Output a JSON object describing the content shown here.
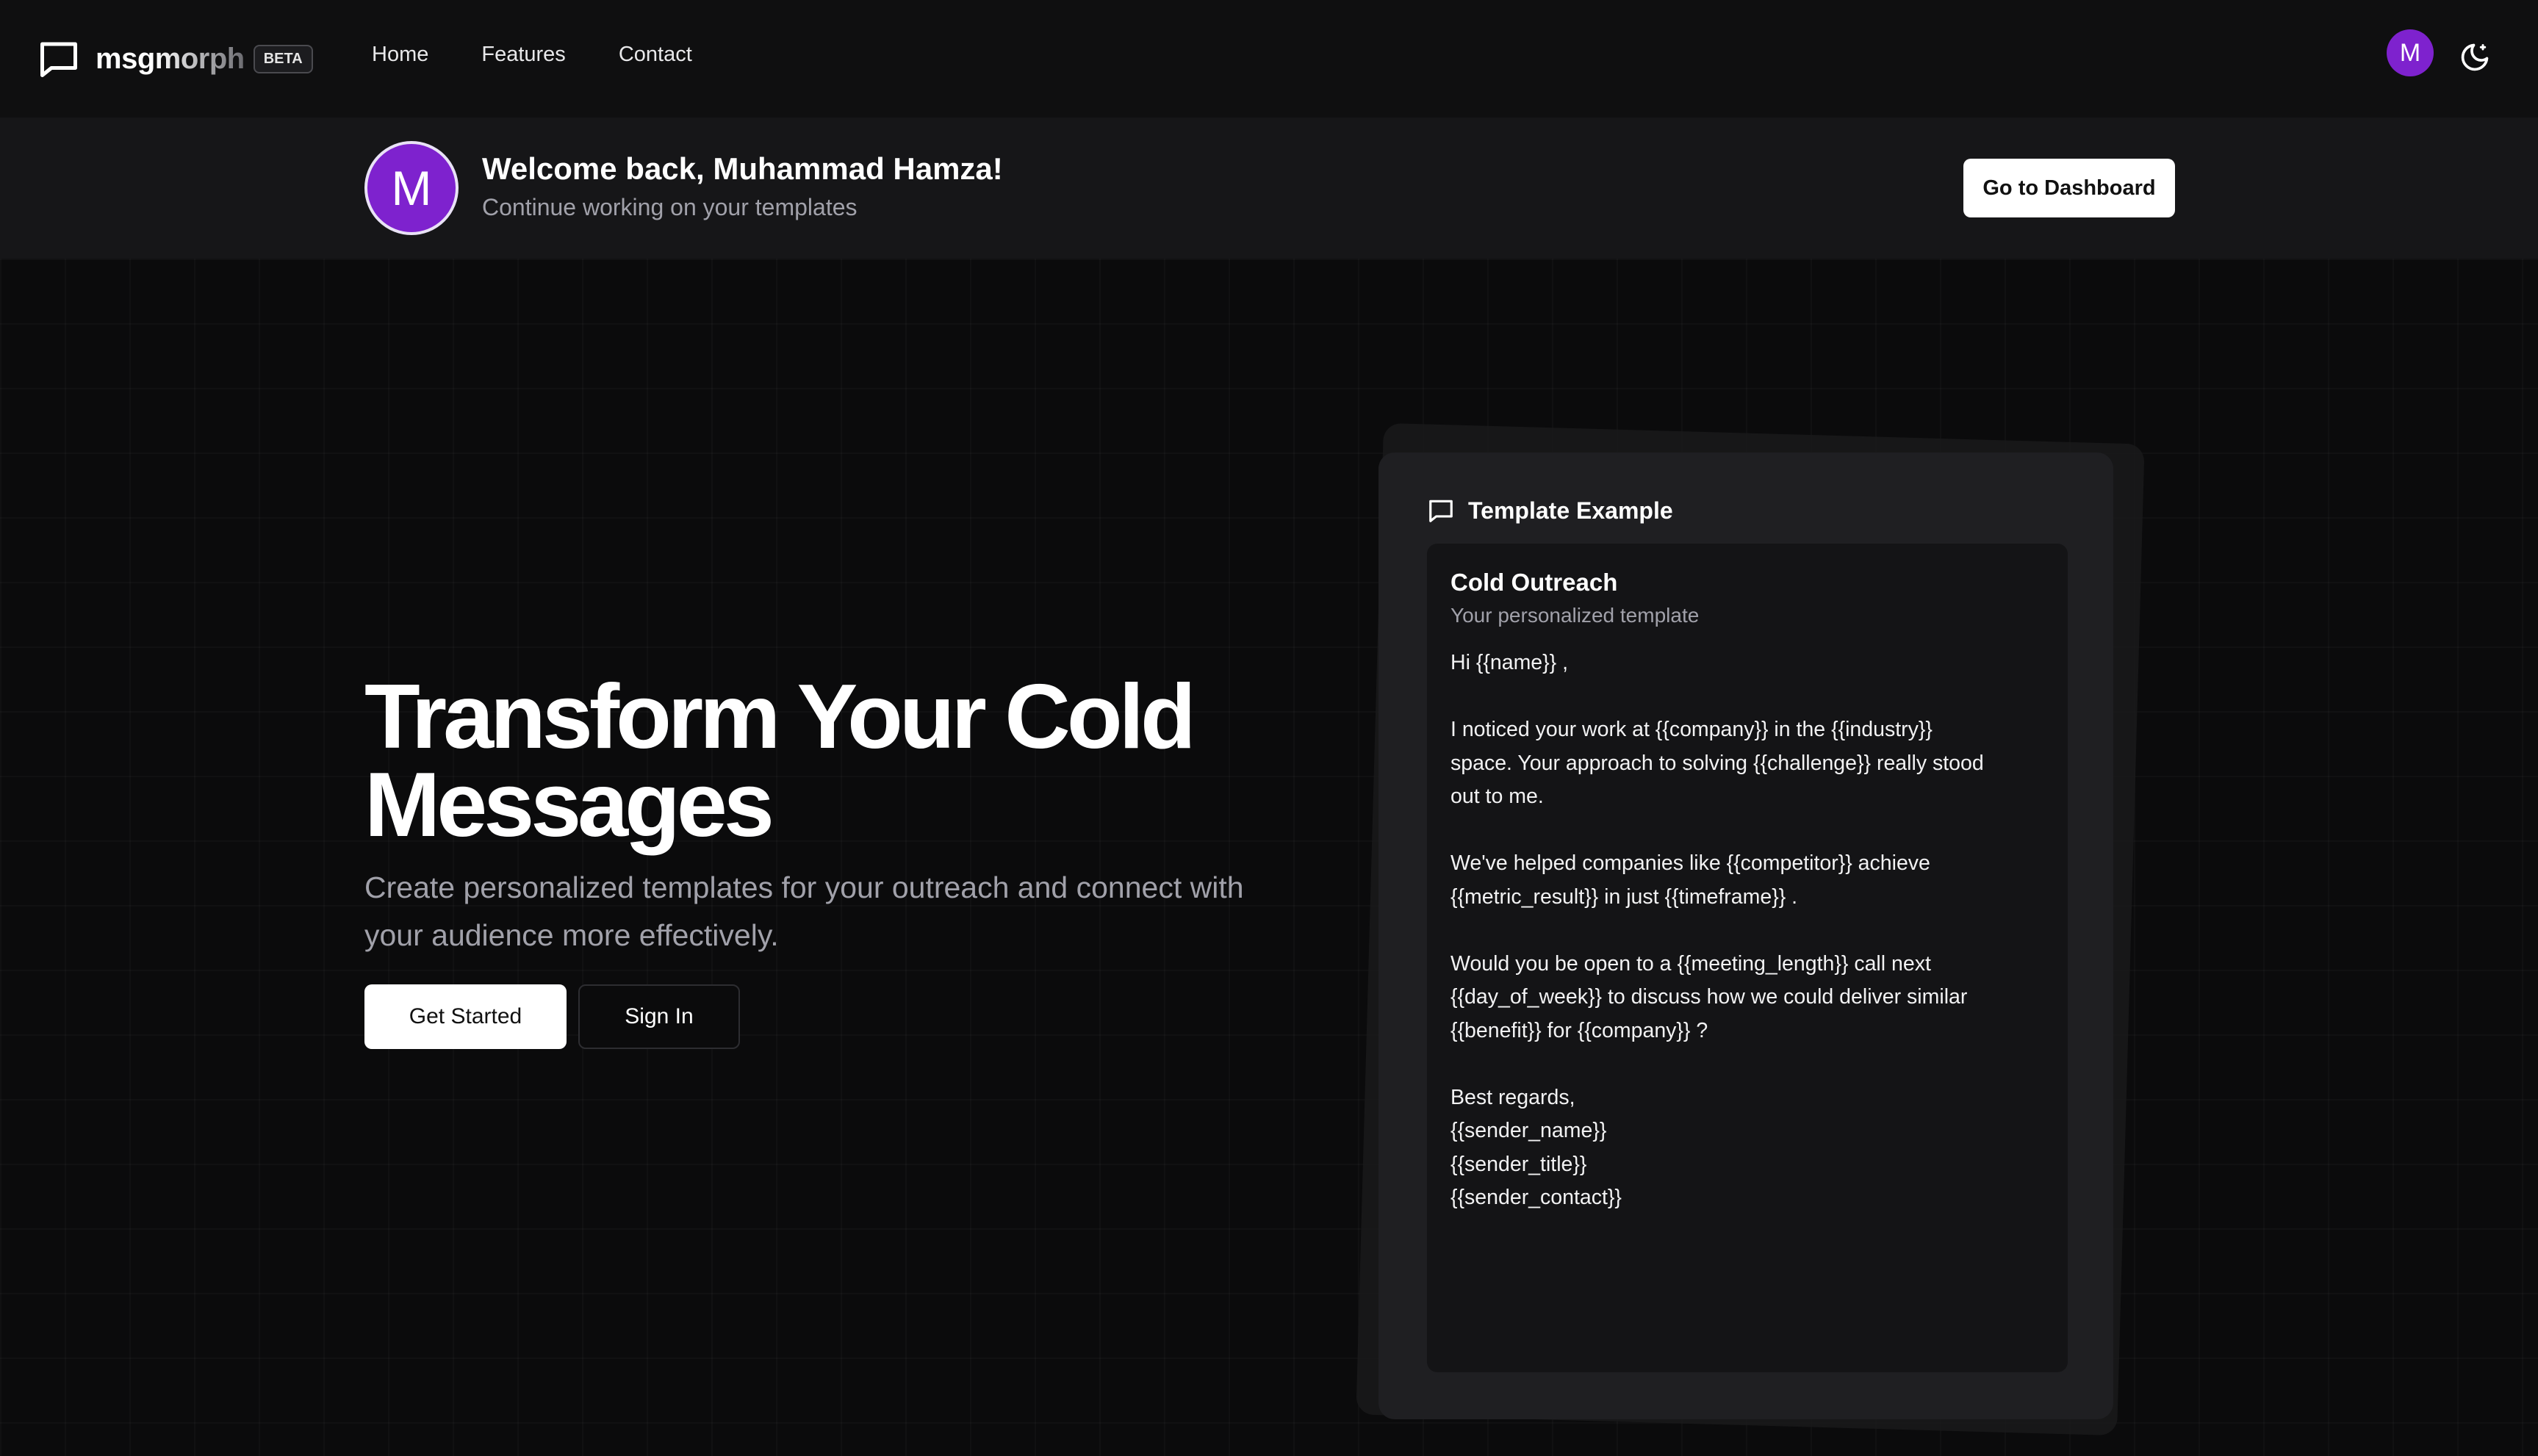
{
  "brand": {
    "name": "msgmorph",
    "badge": "BETA"
  },
  "nav": {
    "links": [
      "Home",
      "Features",
      "Contact"
    ],
    "avatar_initial": "M"
  },
  "welcome": {
    "avatar_initial": "M",
    "title": "Welcome back, Muhammad Hamza!",
    "subtitle": "Continue working on your templates",
    "dashboard_button": "Go to Dashboard"
  },
  "hero": {
    "title_line1": "Transform Your Cold",
    "title_line2": "Messages",
    "subtitle": "Create personalized templates for your outreach and connect with your audience more effectively.",
    "get_started": "Get Started",
    "sign_in": "Sign In"
  },
  "template_card": {
    "header": "Template Example",
    "title": "Cold Outreach",
    "subtitle": "Your personalized template",
    "lines": {
      "greeting": "Hi  {{name}} ,",
      "p1_l1": "I noticed your work at  {{company}}  in the  {{industry}}",
      "p1_l2": "space. Your approach to solving  {{challenge}}  really stood",
      "p1_l3": "out to me.",
      "p2_l1": "We've helped companies like  {{competitor}}  achieve",
      "p2_l2": " {{metric_result}}  in just  {{timeframe}} .",
      "p3_l1": "Would you be open to a  {{meeting_length}}  call next",
      "p3_l2": " {{day_of_week}}  to discuss how we could deliver similar",
      "p3_l3": " {{benefit}}  for  {{company}} ?",
      "sign_l1": "Best regards,",
      "sign_l2": " {{sender_name}}",
      "sign_l3": " {{sender_title}}",
      "sign_l4": " {{sender_contact}}"
    }
  },
  "colors": {
    "accent_purple": "#7e22ce",
    "background": "#0b0b0c"
  }
}
